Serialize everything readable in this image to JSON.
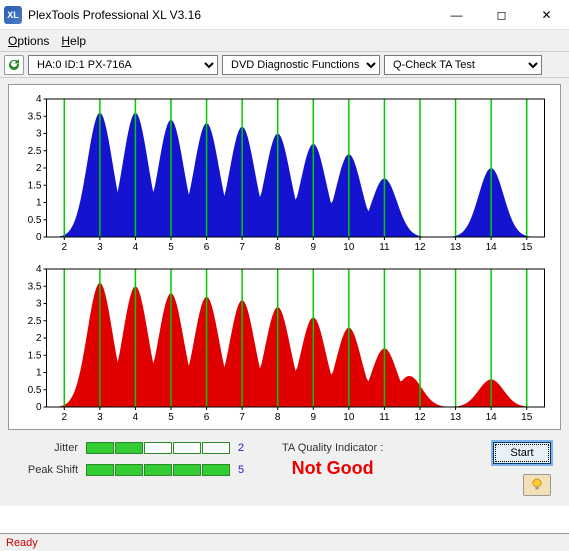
{
  "window": {
    "title": "PlexTools Professional XL V3.16"
  },
  "menu": {
    "options": "Options",
    "help": "Help"
  },
  "toolbar": {
    "device": "HA:0 ID:1  PX-716A",
    "category": "DVD Diagnostic Functions",
    "test": "Q-Check TA Test"
  },
  "chart_data": [
    {
      "type": "area",
      "color": "#1414d0",
      "x_ticks": [
        2,
        3,
        4,
        5,
        6,
        7,
        8,
        9,
        10,
        11,
        12,
        13,
        14,
        15
      ],
      "y_ticks": [
        0,
        0.5,
        1,
        1.5,
        2,
        2.5,
        3,
        3.5,
        4
      ],
      "ylim": [
        0,
        4
      ],
      "xlim": [
        1.5,
        15.5
      ],
      "peaks": [
        {
          "x": 3,
          "y": 3.6
        },
        {
          "x": 4,
          "y": 3.6
        },
        {
          "x": 5,
          "y": 3.4
        },
        {
          "x": 6,
          "y": 3.3
        },
        {
          "x": 7,
          "y": 3.2
        },
        {
          "x": 8,
          "y": 3.0
        },
        {
          "x": 9,
          "y": 2.7
        },
        {
          "x": 10,
          "y": 2.4
        },
        {
          "x": 11,
          "y": 1.7
        },
        {
          "x": 14,
          "y": 2.0
        }
      ],
      "valley": 0
    },
    {
      "type": "area",
      "color": "#e00000",
      "x_ticks": [
        2,
        3,
        4,
        5,
        6,
        7,
        8,
        9,
        10,
        11,
        12,
        13,
        14,
        15
      ],
      "y_ticks": [
        0,
        0.5,
        1,
        1.5,
        2,
        2.5,
        3,
        3.5,
        4
      ],
      "ylim": [
        0,
        4
      ],
      "xlim": [
        1.5,
        15.5
      ],
      "peaks": [
        {
          "x": 3,
          "y": 3.6
        },
        {
          "x": 4,
          "y": 3.5
        },
        {
          "x": 5,
          "y": 3.3
        },
        {
          "x": 6,
          "y": 3.2
        },
        {
          "x": 7,
          "y": 3.1
        },
        {
          "x": 8,
          "y": 2.9
        },
        {
          "x": 9,
          "y": 2.6
        },
        {
          "x": 10,
          "y": 2.3
        },
        {
          "x": 11,
          "y": 1.7
        },
        {
          "x": 11.7,
          "y": 0.9
        },
        {
          "x": 14,
          "y": 0.8
        }
      ],
      "valley": 0
    }
  ],
  "metrics": {
    "jitter_label": "Jitter",
    "jitter_value": "2",
    "jitter_filled": 2,
    "peakshift_label": "Peak Shift",
    "peakshift_value": "5",
    "peakshift_filled": 5
  },
  "ta": {
    "label": "TA Quality Indicator :",
    "value": "Not Good"
  },
  "buttons": {
    "start": "Start"
  },
  "status": {
    "text": "Ready"
  }
}
